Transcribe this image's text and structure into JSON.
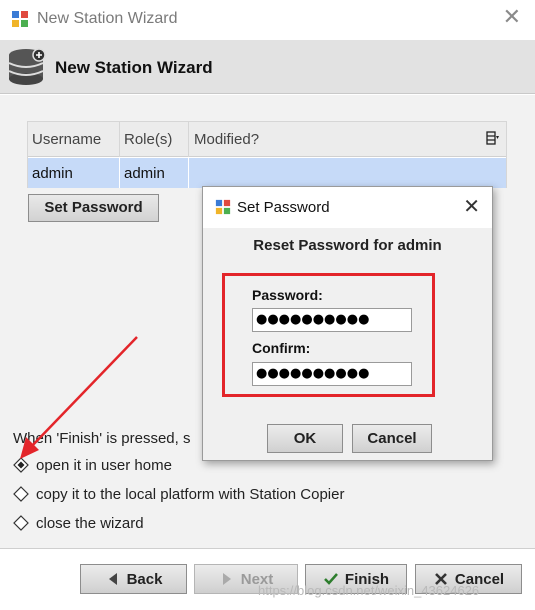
{
  "window": {
    "title": "New Station Wizard",
    "wizard_title": "New Station Wizard"
  },
  "table": {
    "columns": [
      "Username",
      "Role(s)",
      "Modified?"
    ],
    "rows": [
      {
        "username": "admin",
        "role": "admin",
        "modified": ""
      }
    ]
  },
  "buttons": {
    "set_password": "Set Password"
  },
  "finish_text": "When 'Finish' is pressed, s",
  "options": [
    {
      "label": "open it in user home",
      "selected": true
    },
    {
      "label": "copy it to the local platform with Station Copier",
      "selected": false
    },
    {
      "label": "close the wizard",
      "selected": false
    }
  ],
  "footer": {
    "back": "Back",
    "next": "Next",
    "finish": "Finish",
    "cancel": "Cancel"
  },
  "watermark": "https://blog.csdn.net/weixin_43624626",
  "dialog": {
    "title": "Set Password",
    "heading": "Reset Password for admin",
    "password_label": "Password:",
    "password_value": "●●●●●●●●●●",
    "confirm_label": "Confirm:",
    "confirm_value": "●●●●●●●●●●",
    "ok": "OK",
    "cancel": "Cancel"
  },
  "colors": {
    "highlight": "#e3252a",
    "selection": "#c6daf8",
    "arrow": "#e3252a"
  }
}
